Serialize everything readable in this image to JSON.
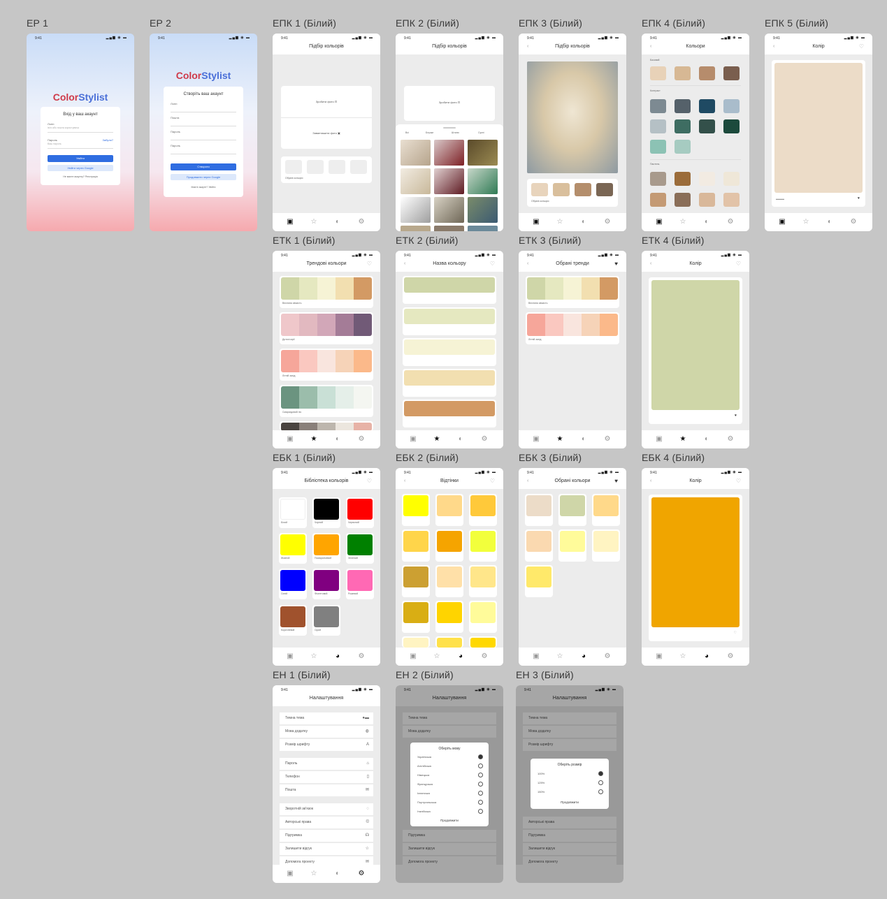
{
  "frames": {
    "ep1": "ЕР 1",
    "ep2": "ЕР 2",
    "epk1": "ЕПК 1 (Білий)",
    "epk2": "ЕПК 2 (Білий)",
    "epk3": "ЕПК 3 (Білий)",
    "epk4": "ЕПК 4 (Білий)",
    "epk5": "ЕПК 5 (Білий)",
    "etk1": "ЕТК 1 (Білий)",
    "etk2": "ЕТК 2 (Білий)",
    "etk3": "ЕТК 3 (Білий)",
    "etk4": "ЕТК 4 (Білий)",
    "ebk1": "ЕБК 1 (Білий)",
    "ebk2": "ЕБК 2 (Білий)",
    "ebk3": "ЕБК 3 (Білий)",
    "ebk4": "ЕБК 4 (Білий)",
    "en1": "ЕН 1 (Білий)",
    "en2": "ЕН 2 (Білий)",
    "en3": "ЕН 3 (Білий)"
  },
  "status": {
    "time": "9:41",
    "signal": "▂▄▆ ◉ ▬"
  },
  "brand": {
    "color": "Color",
    "stylist": "Stylist"
  },
  "auth": {
    "login_title": "Вхід у ваш акаунт",
    "login_field_label": "Логін",
    "login_placeholder": "Ім'я або пошта користувача",
    "password_label": "Пароль",
    "forgot": "Забули?",
    "password_placeholder": "Ваш пароль",
    "login_button": "Увійти",
    "google_login": "Увійти через Google",
    "no_account": "Не маєте акаунту? Реєстрація",
    "register_title": "Створіть ваш акаунт",
    "name_label": "Логін",
    "email_label": "Пошта",
    "password_repeat_label": "Пароль",
    "create_button": "Створити",
    "google_register": "Продовжити через Google",
    "have_account": "Маєте акаунт? Увійти"
  },
  "headers": {
    "color_pick": "Підбір кольорів",
    "colors": "Кольори",
    "color": "Колір",
    "trend_colors": "Трендові кольори",
    "color_name": "Назва кольору",
    "chosen_trends": "Обрані тренди",
    "library": "Бібліотека кольорів",
    "shades": "Відтінки",
    "chosen_colors": "Обрані кольори",
    "settings": "Налаштування"
  },
  "picker": {
    "take_photo": "Зробити фото",
    "upload_photo": "Завантажити фото",
    "selected_colors": "Обрані кольори"
  },
  "gallery_tabs": [
    "Всі",
    "Блузки",
    "Штани",
    "Сукні"
  ],
  "palette_sections": [
    "Базовий",
    "Контраст",
    "Пастель"
  ],
  "trend_names": [
    "Весняна свіжість",
    "Дитячі мрії",
    "Літній захід",
    "Смарагдовий ліс"
  ],
  "swatch_names": [
    "Білий",
    "Чорний",
    "Червоний",
    "Жовтий",
    "Помаранчевий",
    "Зелений",
    "Синій",
    "Фіолетовий",
    "Рожевий",
    "Коричневий",
    "Сірий"
  ],
  "settings": {
    "group1": [
      "Темна тема",
      "Мова додатку",
      "Розмір шрифту"
    ],
    "group2": [
      "Пароль",
      "Телефон",
      "Пошта"
    ],
    "group3": [
      "Зворотній зв'язок",
      "Авторські права",
      "Підтримка",
      "Залишити відгук",
      "Допомога проекту"
    ],
    "lang_title": "Оберіть мову",
    "languages": [
      "Українська",
      "Англійська",
      "Німецька",
      "Французька",
      "Іспанська",
      "Португальська",
      "Італійська"
    ],
    "size_title": "Оберіть розмір",
    "sizes": [
      "100%",
      "125%",
      "150%"
    ],
    "continue": "Продовжити"
  },
  "colors": {
    "accent": "#2f6de1",
    "brand_red": "#cf3a4a",
    "brand_blue": "#4a6fd8",
    "big_beige": "#ecdcc8",
    "big_sage": "#cfd6a8",
    "big_amber": "#f0a500"
  }
}
